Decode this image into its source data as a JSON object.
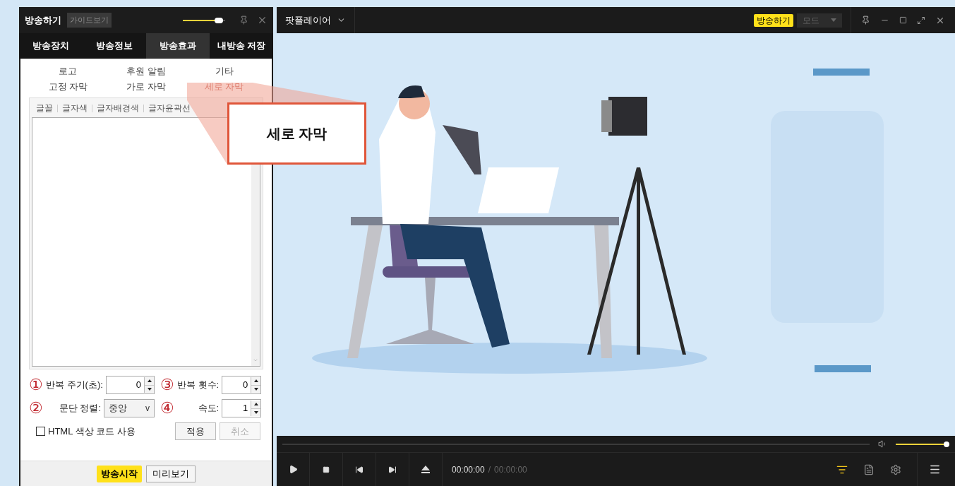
{
  "panel": {
    "title": "방송하기",
    "guide_button": "가이드보기",
    "opacity_slider": {
      "level": 0.85
    },
    "tabs": [
      {
        "label": "방송장치",
        "selected": false
      },
      {
        "label": "방송정보",
        "selected": false
      },
      {
        "label": "방송효과",
        "selected": true
      },
      {
        "label": "내방송 저장",
        "selected": false
      }
    ],
    "subtabs": [
      {
        "label": "로고",
        "selected": false
      },
      {
        "label": "후원 알림",
        "selected": false
      },
      {
        "label": "기타",
        "selected": false
      },
      {
        "label": "고정 자막",
        "selected": false
      },
      {
        "label": "가로 자막",
        "selected": false
      },
      {
        "label": "세로 자막",
        "selected": true
      }
    ],
    "format_tools": [
      "글꼴",
      "글자색",
      "글자배경색",
      "글자윤곽선"
    ],
    "fields": [
      {
        "marker": "①",
        "label": "반복 주기(초):",
        "value": "0",
        "kind": "spinner"
      },
      {
        "marker": "③",
        "label": "반복 횟수:",
        "value": "0",
        "kind": "spinner"
      },
      {
        "marker": "②",
        "label": "문단 정렬:",
        "value": "중앙",
        "caret": "v",
        "kind": "select"
      },
      {
        "marker": "④",
        "label": "속도:",
        "value": "1",
        "kind": "spinner"
      }
    ],
    "checkbox": {
      "label": "HTML 색상 코드 사용",
      "checked": false
    },
    "apply_button": {
      "label": "적용",
      "disabled": false
    },
    "cancel_button": {
      "label": "취소",
      "disabled": true
    },
    "start_button": "방송시작",
    "preview_button": "미리보기"
  },
  "callout": {
    "text": "세로 자막"
  },
  "player": {
    "title": "팟플레이어",
    "broadcast_badge": "방송하기",
    "mode_dropdown": {
      "label": "모드",
      "disabled": true
    },
    "seek": {
      "level": 0
    },
    "volume": {
      "level": 0.95
    },
    "time_current": "00:00:00",
    "time_separator": "/",
    "time_total": "00:00:00"
  }
}
